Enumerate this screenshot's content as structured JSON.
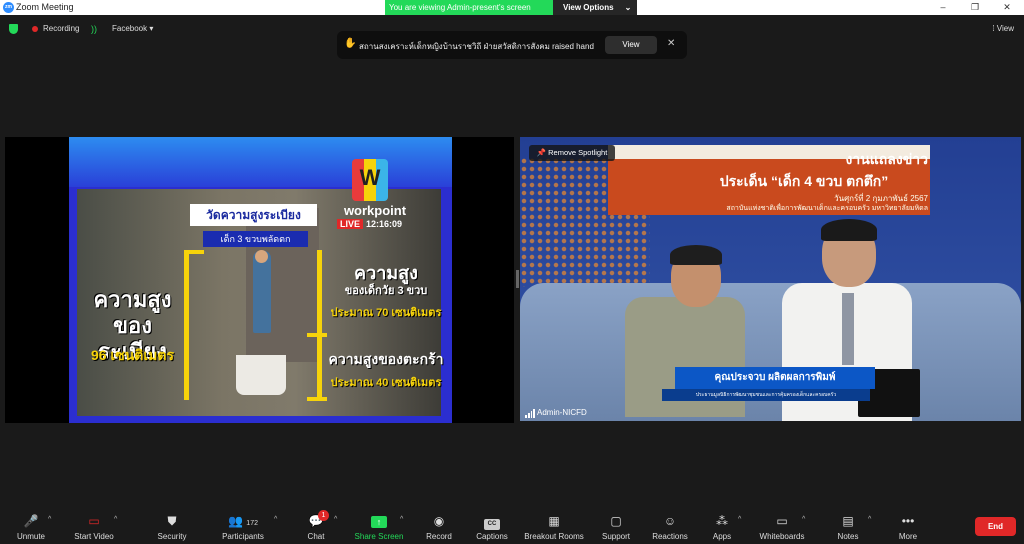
{
  "window": {
    "title": "Zoom Meeting",
    "app_icon": "zm",
    "minimize": "–",
    "maximize": "❐",
    "close": "✕"
  },
  "banner": {
    "text": "You are viewing Admin-present's screen",
    "button": "View Options",
    "chevron": "⌄"
  },
  "topbar": {
    "recording_label": "Recording",
    "stream_label": "Facebook ▾",
    "view_label": "⁞ View"
  },
  "notification": {
    "text": "สถานสงเคราะห์เด็กหญิงบ้านราชวิถี ฝ่ายสวัสดิการสังคม raised hand",
    "view_button": "View",
    "close": "✕"
  },
  "left_video": {
    "tv_title": "วัดความสูงระเบียง",
    "tv_subtitle": "เด็ก 3 ขวบพลัดตก",
    "stair_label": "ความสูงของระเบียง",
    "stair_value": "96 เซนติเมตร",
    "kid_label": "ความสูง",
    "kid_sub": "ของเด็กวัย 3 ขวบ",
    "kid_value": "ประมาณ 70 เซนติเมตร",
    "basket_label": "ความสูงของตะกร้า",
    "basket_value": "ประมาณ 40 เซนติเมตร",
    "logo_letter": "W",
    "logo_name": "workpoint",
    "live_badge": "LIVE",
    "live_time": "12:16:09"
  },
  "right_video": {
    "remove_spotlight": "Remove Spotlight",
    "poster_title": "งานแถลงข่าว",
    "poster_headline": "ประเด็น “เด็ก 4 ขวบ ตกตึก”",
    "poster_date": "วันศุกร์ที่ 2 กุมภาพันธ์ 2567",
    "poster_org": "สถาบันแห่งชาติเพื่อการพัฒนาเด็กและครอบครัว มหาวิทยาลัยมหิดล",
    "nameplate": "คุณประจวบ ผลิตผลการพิมพ์",
    "nameplate_sub": "ประธานมูลนิธิการพัฒนาชุมชนและการคุ้มครองเด็กและครอบครัว",
    "participant": "Admin-NICFD"
  },
  "toolbar": {
    "items": [
      {
        "label": "Unmute",
        "icon": "🎤"
      },
      {
        "label": "Start Video",
        "icon": "▭"
      },
      {
        "label": "Security",
        "icon": "⛊"
      },
      {
        "label": "Participants",
        "icon": "👥",
        "count": "172"
      },
      {
        "label": "Chat",
        "icon": "💬",
        "badge": "1"
      },
      {
        "label": "Share Screen",
        "icon": "↑"
      },
      {
        "label": "Record",
        "icon": "◉"
      },
      {
        "label": "Captions",
        "icon": "CC"
      },
      {
        "label": "Breakout Rooms",
        "icon": "▦"
      },
      {
        "label": "Support",
        "icon": "▢"
      },
      {
        "label": "Reactions",
        "icon": "☺"
      },
      {
        "label": "Apps",
        "icon": "⁂"
      },
      {
        "label": "Whiteboards",
        "icon": "▭"
      },
      {
        "label": "Notes",
        "icon": "▤"
      },
      {
        "label": "More",
        "icon": "•••"
      }
    ],
    "caret": "^",
    "end_label": "End"
  },
  "colors": {
    "accent_green": "#23d959",
    "end_red": "#e02828",
    "background": "#1a1a1a"
  }
}
